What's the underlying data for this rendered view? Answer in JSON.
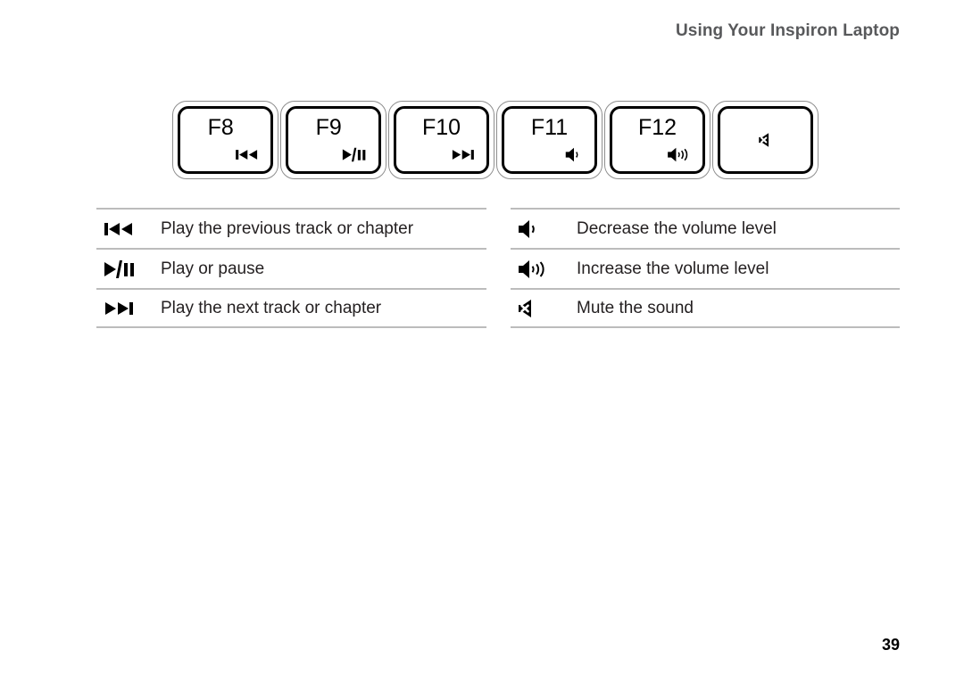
{
  "header": {
    "title": "Using Your Inspiron Laptop"
  },
  "keyrow": {
    "keys": [
      {
        "label": "F8",
        "icon": "previous-track-icon",
        "icon_position": "corner"
      },
      {
        "label": "F9",
        "icon": "play-pause-icon",
        "icon_position": "corner"
      },
      {
        "label": "F10",
        "icon": "next-track-icon",
        "icon_position": "corner"
      },
      {
        "label": "F11",
        "icon": "volume-down-icon",
        "icon_position": "corner"
      },
      {
        "label": "F12",
        "icon": "volume-up-icon",
        "icon_position": "corner"
      },
      {
        "label": "",
        "icon": "mute-icon",
        "icon_position": "center"
      }
    ]
  },
  "legend_left": {
    "rows": [
      {
        "icon": "previous-track-icon",
        "text": "Play the previous track or chapter"
      },
      {
        "icon": "play-pause-icon",
        "text": "Play or pause"
      },
      {
        "icon": "next-track-icon",
        "text": "Play the next track or chapter"
      }
    ]
  },
  "legend_right": {
    "rows": [
      {
        "icon": "volume-down-icon",
        "text": "Decrease the volume level"
      },
      {
        "icon": "volume-up-icon",
        "text": "Increase the volume level"
      },
      {
        "icon": "mute-icon",
        "text": "Mute the sound"
      }
    ]
  },
  "footer": {
    "page_number": "39"
  },
  "colors": {
    "background": "#ffffff",
    "header_text": "#58595b",
    "body_text": "#231f20",
    "rule": "#bcbcbc",
    "key_outer_border": "#8e8e8e",
    "key_inner_border": "#000000",
    "icon": "#000000"
  }
}
